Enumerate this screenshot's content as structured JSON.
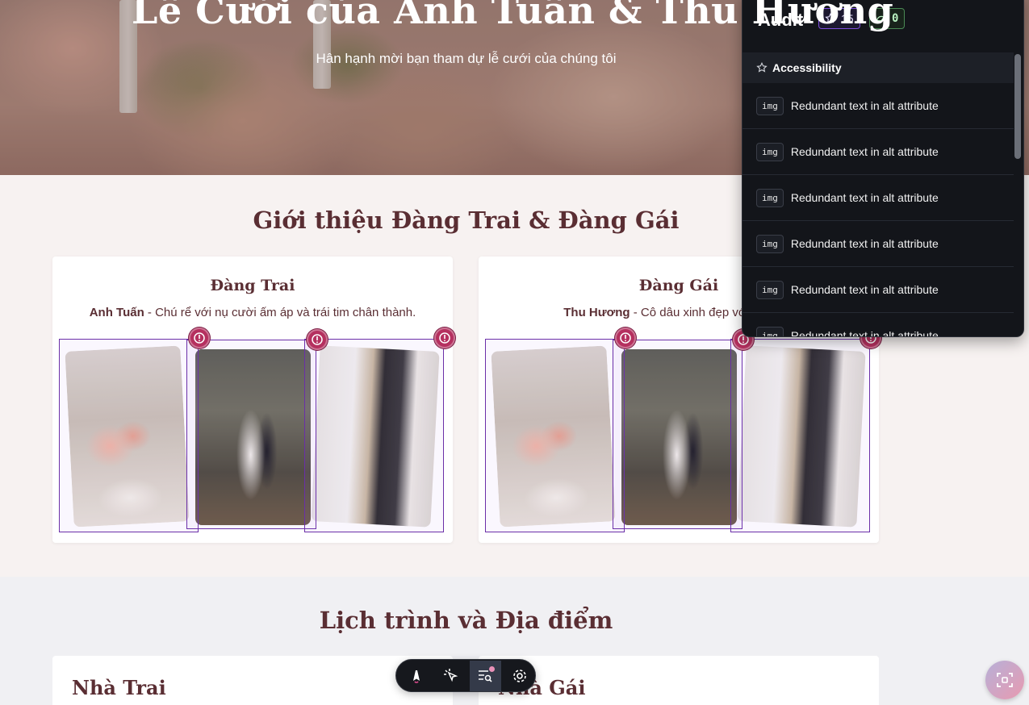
{
  "hero": {
    "title": "Lễ Cưới của Anh Tuấn & Thu Hương",
    "subtitle": "Hân hạnh mời bạn tham dự lễ cưới của chúng tôi"
  },
  "intro": {
    "title": "Giới thiệu Đàng Trai & Đàng Gái",
    "groom": {
      "heading": "Đàng Trai",
      "name": "Anh Tuấn",
      "text": " - Chú rể với nụ cười ấm áp và trái tim chân thành."
    },
    "bride": {
      "heading": "Đàng Gái",
      "name": "Thu Hương",
      "text": " - Cô dâu xinh đẹp với nụ cười"
    }
  },
  "schedule": {
    "title": "Lịch trình và Địa điểm",
    "groom_home": "Nhà Trai",
    "bride_home": "Nhà Gái"
  },
  "audit": {
    "title": "Audit",
    "accessibility_count": "15",
    "performance_count": "0",
    "category": "Accessibility",
    "items": [
      {
        "tag": "img",
        "text": "Redundant text in alt attribute"
      },
      {
        "tag": "img",
        "text": "Redundant text in alt attribute"
      },
      {
        "tag": "img",
        "text": "Redundant text in alt attribute"
      },
      {
        "tag": "img",
        "text": "Redundant text in alt attribute"
      },
      {
        "tag": "img",
        "text": "Redundant text in alt attribute"
      },
      {
        "tag": "img",
        "text": "Redundant text in alt attribute"
      }
    ]
  },
  "toolbar": {
    "icons": [
      "astro-logo-icon",
      "inspect-cursor-icon",
      "audit-icon",
      "settings-gear-icon"
    ]
  },
  "colors": {
    "heading": "#5a2e33",
    "audit_bg": "#13151a",
    "warning": "#b5305f",
    "selection": "#6b2fa8"
  }
}
